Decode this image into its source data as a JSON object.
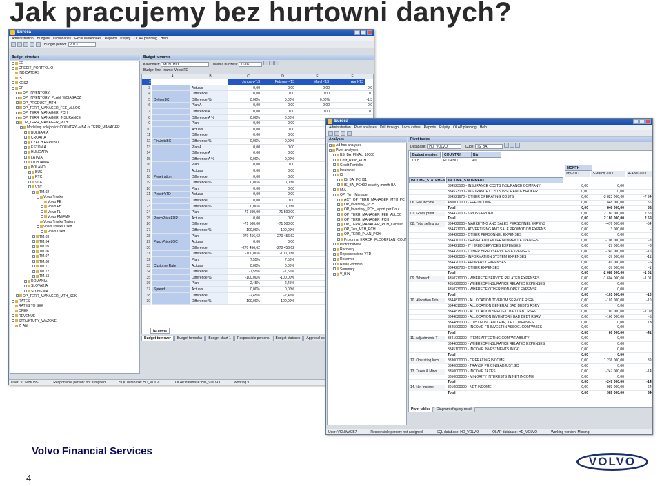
{
  "slide": {
    "title": "Jak pracujemy bez hurtowni danych?",
    "company": "Volvo Financial Services",
    "page_number": "4",
    "logo_text": "VOLVO"
  },
  "win1": {
    "title": "Eureca",
    "menu": [
      "Administration",
      "Budgets",
      "Dictionaries",
      "Excel Workbooks",
      "Reports",
      "Pulpity",
      "OLAP planning",
      "Help"
    ],
    "budget_period_label": "Budget period:",
    "budget_period_value": "2013",
    "left_panel_title": "Budget structure",
    "right_panel_title": "Budget turnover",
    "kalendarz_label": "Kalendarz:",
    "kalendarz_value": "MONTHLY",
    "wersja_label": "Wersja budżetu:",
    "wersja_value": "11/06",
    "node_label": "Budget line - name: Volvo FE",
    "tree": [
      {
        "t": "EG",
        "l": 0
      },
      {
        "t": "CREDIT_PORTFOLIO",
        "l": 0
      },
      {
        "t": "INDICATORS",
        "l": 0
      },
      {
        "t": "IS",
        "l": 0
      },
      {
        "t": "KOSZ",
        "l": 0
      },
      {
        "t": "OP",
        "l": 0
      },
      {
        "t": "OP_INVENTORY",
        "l": 1
      },
      {
        "t": "OP_INVENTORY_PLAN_WCIAGACZ",
        "l": 1
      },
      {
        "t": "OP_PRODUCT_MTH",
        "l": 1
      },
      {
        "t": "OP_TERR_MANAGER_FEE_ALLOC",
        "l": 1
      },
      {
        "t": "OP_TERR_MANAGER_PCH",
        "l": 1
      },
      {
        "t": "OP_TERR_MANAGER_INSURANCE",
        "l": 1
      },
      {
        "t": "OP_TERR_MANAGER_MTH",
        "l": 1
      },
      {
        "t": "Model wg kolejności: COUNTRY -> BA -> TERR_MANAGER",
        "l": 2
      },
      {
        "t": "BULGARIA",
        "l": 3
      },
      {
        "t": "CROATIA",
        "l": 3
      },
      {
        "t": "CZECH REPUBLIC",
        "l": 3
      },
      {
        "t": "ESTONIA",
        "l": 3
      },
      {
        "t": "HUNGARY",
        "l": 3
      },
      {
        "t": "LATVIA",
        "l": 3
      },
      {
        "t": "LITHUANIA",
        "l": 3
      },
      {
        "t": "POLAND",
        "l": 3
      },
      {
        "t": "BUS",
        "l": 4
      },
      {
        "t": "RTC",
        "l": 4
      },
      {
        "t": "VCE",
        "l": 4
      },
      {
        "t": "VTC",
        "l": 4
      },
      {
        "t": "TM.02",
        "l": 5
      },
      {
        "t": "Volvo Trucks",
        "l": 6
      },
      {
        "t": "Volvo FE",
        "l": 7
      },
      {
        "t": "Volvo FH",
        "l": 7
      },
      {
        "t": "Volvo FL",
        "l": 7
      },
      {
        "t": "Volvo FM/FMX",
        "l": 7
      },
      {
        "t": "Volvo Trucks Trailers",
        "l": 6
      },
      {
        "t": "Volvo Trucks Used",
        "l": 6
      },
      {
        "t": "Volvo Used",
        "l": 7
      },
      {
        "t": "TM.03",
        "l": 5
      },
      {
        "t": "TM.04",
        "l": 5
      },
      {
        "t": "TM.05",
        "l": 5
      },
      {
        "t": "TM.06",
        "l": 5
      },
      {
        "t": "TM.07",
        "l": 5
      },
      {
        "t": "TM.08",
        "l": 5
      },
      {
        "t": "TM.11",
        "l": 5
      },
      {
        "t": "TM.12",
        "l": 5
      },
      {
        "t": "TM.13",
        "l": 5
      },
      {
        "t": "ROMANIA",
        "l": 3
      },
      {
        "t": "SLOVAKIA",
        "l": 3
      },
      {
        "t": "SLOVENIA",
        "l": 3
      },
      {
        "t": "OP_TERR_MANAGER_MTH_SEK",
        "l": 1
      },
      {
        "t": "RATES",
        "l": 0
      },
      {
        "t": "RATES TO SEK",
        "l": 0
      },
      {
        "t": "OPEX",
        "l": 0
      },
      {
        "t": "REVENUE",
        "l": 0
      },
      {
        "t": "STRUKTURY_WAZONE",
        "l": 0
      },
      {
        "t": "Z_ANI",
        "l": 0
      }
    ],
    "col_letters": [
      "A",
      "B",
      "C",
      "D",
      "E",
      "F"
    ],
    "col_headers": [
      "January-'13",
      "February-'13",
      "March-'13",
      "April-'13"
    ],
    "rows": [
      {
        "n": "3",
        "a": "",
        "b": "Actuals",
        "c": "0,00",
        "d": "0,00",
        "e": "0,00",
        "f": "0,0"
      },
      {
        "n": "4",
        "a": "",
        "b": "Difference",
        "c": "0,00",
        "d": "0,00",
        "e": "0,00",
        "f": "0,0"
      },
      {
        "n": "5",
        "a": "DeliverBC",
        "b": "Difference %",
        "c": "0,00%",
        "d": "0,00%",
        "e": "0,00%",
        "f": "-1,3"
      },
      {
        "n": "6",
        "a": "",
        "b": "Plan A",
        "c": "0,00",
        "d": "0,00",
        "e": "0,00",
        "f": "0,0"
      },
      {
        "n": "7",
        "a": "",
        "b": "Difference A",
        "c": "0,00",
        "d": "0,00",
        "e": "0,00",
        "f": "0,0"
      },
      {
        "n": "8",
        "a": "",
        "b": "Difference A %",
        "c": "0,00%",
        "d": "0,00%",
        "e": "",
        "f": ""
      },
      {
        "n": "9",
        "a": "",
        "b": "Plan",
        "c": "0,00",
        "d": "0,00",
        "e": "",
        "f": ""
      },
      {
        "n": "10",
        "a": "",
        "b": "Actuals",
        "c": "0,00",
        "d": "0,00",
        "e": "",
        "f": ""
      },
      {
        "n": "11",
        "a": "",
        "b": "Difference",
        "c": "0,00",
        "d": "0,00",
        "e": "",
        "f": ""
      },
      {
        "n": "12",
        "a": "FinUnitsBC",
        "b": "Difference %",
        "c": "0,00%",
        "d": "0,00%",
        "e": "",
        "f": ""
      },
      {
        "n": "13",
        "a": "",
        "b": "Plan A",
        "c": "0,00",
        "d": "0,00",
        "e": "",
        "f": ""
      },
      {
        "n": "14",
        "a": "",
        "b": "Difference A",
        "c": "0,00",
        "d": "0,00",
        "e": "",
        "f": ""
      },
      {
        "n": "15",
        "a": "",
        "b": "Difference A %",
        "c": "0,00%",
        "d": "0,00%",
        "e": "",
        "f": ""
      },
      {
        "n": "16",
        "a": "",
        "b": "Plan",
        "c": "0,00",
        "d": "0,00",
        "e": "",
        "f": ""
      },
      {
        "n": "17",
        "a": "",
        "b": "Actuals",
        "c": "0,00",
        "d": "0,00",
        "e": "",
        "f": ""
      },
      {
        "n": "18",
        "a": "Penetration",
        "b": "Difference",
        "c": "0,00",
        "d": "0,00",
        "e": "",
        "f": ""
      },
      {
        "n": "19",
        "a": "",
        "b": "Difference %",
        "c": "0,00%",
        "d": "0,00%",
        "e": "",
        "f": ""
      },
      {
        "n": "20",
        "a": "",
        "b": "Plan",
        "c": "0,00",
        "d": "0,00",
        "e": "",
        "f": ""
      },
      {
        "n": "21",
        "a": "PenetrYTD",
        "b": "Actuals",
        "c": "0,00",
        "d": "0,00",
        "e": "",
        "f": ""
      },
      {
        "n": "22",
        "a": "",
        "b": "Difference",
        "c": "0,00",
        "d": "0,00",
        "e": "",
        "f": ""
      },
      {
        "n": "23",
        "a": "",
        "b": "Difference %",
        "c": "0,00%",
        "d": "0,00%",
        "e": "",
        "f": ""
      },
      {
        "n": "24",
        "a": "",
        "b": "Plan",
        "c": "71 500,00",
        "d": "71 500,00",
        "e": "7",
        "f": ""
      },
      {
        "n": "25",
        "a": "PurchPriceEUR",
        "b": "Actuals",
        "c": "0,00",
        "d": "0,00",
        "e": "",
        "f": ""
      },
      {
        "n": "26",
        "a": "",
        "b": "Difference",
        "c": "-71 500,00",
        "d": "-71 500,00",
        "e": "-7",
        "f": ""
      },
      {
        "n": "27",
        "a": "",
        "b": "Difference %",
        "c": "-100,00%",
        "d": "-100,00%",
        "e": "-",
        "f": ""
      },
      {
        "n": "28",
        "a": "",
        "b": "Plan",
        "c": "270 456,62",
        "d": "270 456,62",
        "e": "27",
        "f": ""
      },
      {
        "n": "29",
        "a": "PurchPriceLOC",
        "b": "Actuals",
        "c": "0,00",
        "d": "0,00",
        "e": "",
        "f": ""
      },
      {
        "n": "30",
        "a": "",
        "b": "Difference",
        "c": "-270 456,62",
        "d": "-270 456,62",
        "e": "-27",
        "f": ""
      },
      {
        "n": "31",
        "a": "",
        "b": "Difference %",
        "c": "-100,00%",
        "d": "-100,00%",
        "e": "-",
        "f": ""
      },
      {
        "n": "32",
        "a": "",
        "b": "Plan",
        "c": "7,55%",
        "d": "7,56%",
        "e": "",
        "f": ""
      },
      {
        "n": "33",
        "a": "CustomerRate",
        "b": "Actuals",
        "c": "0,00%",
        "d": "0,00%",
        "e": "",
        "f": ""
      },
      {
        "n": "34",
        "a": "",
        "b": "Difference",
        "c": "-7,55%",
        "d": "-7,56%",
        "e": "",
        "f": ""
      },
      {
        "n": "35",
        "a": "",
        "b": "Difference %",
        "c": "-100,00%",
        "d": "-100,00%",
        "e": "-",
        "f": ""
      },
      {
        "n": "36",
        "a": "",
        "b": "Plan",
        "c": "2,45%",
        "d": "2,45%",
        "e": "",
        "f": ""
      },
      {
        "n": "37",
        "a": "Spread",
        "b": "Actuals",
        "c": "0,00%",
        "d": "0,00%",
        "e": "",
        "f": ""
      },
      {
        "n": "38",
        "a": "",
        "b": "Difference",
        "c": "-2,45%",
        "d": "-2,45%",
        "e": "",
        "f": ""
      },
      {
        "n": "39",
        "a": "",
        "b": "Difference %",
        "c": "-100,00%",
        "d": "-100,00%",
        "e": "-",
        "f": ""
      }
    ],
    "sheet_tab": "turnover",
    "bottom_tabs": [
      "Budget turnover",
      "Budget formulas",
      "Budget chart 1",
      "Responsible persons",
      "Budget statuses",
      "Approval co"
    ],
    "status": [
      "User: VCN\\fw0357",
      "Responsible person: not assigned",
      "SQL database: HD_VOLVO",
      "OLAP database: HD_VOLVO",
      "Working v"
    ]
  },
  "win2": {
    "title": "Eureca",
    "menu": [
      "Administration",
      "Pivot analyses",
      "Drill through",
      "Local cubes",
      "Reports",
      "Pulpity",
      "OLAP planning",
      "Help"
    ],
    "left_panel_title": "Analyses",
    "right_panel_title": "Pivot tables",
    "database_label": "Database:",
    "database_value": "HD_VOLVO",
    "cube_label": "Cube:",
    "cube_value": "IS_BA",
    "tree": [
      {
        "t": "Ad-hoc analyses",
        "l": 0
      },
      {
        "t": "Pivot analyses",
        "l": 0
      },
      {
        "t": "BS_BA_FINAL_10000",
        "l": 1
      },
      {
        "t": "Cost_Ratio_PCH",
        "l": 1
      },
      {
        "t": "Credit Portfolio",
        "l": 1
      },
      {
        "t": "Insurance",
        "l": 1
      },
      {
        "t": "IS",
        "l": 1
      },
      {
        "t": "IS_BA_PCH01",
        "l": 2
      },
      {
        "t": "IS_BA_PCH02 country-month-BA",
        "l": 2
      },
      {
        "t": "MIA",
        "l": 1
      },
      {
        "t": "OP_Terr_Manager",
        "l": 1
      },
      {
        "t": "ACT_OP_TERR_MANAGER_MTH_PC",
        "l": 2
      },
      {
        "t": "OP_Inventory_PCH",
        "l": 2
      },
      {
        "t": "OP_Inventory_PCH_report per Cou",
        "l": 2
      },
      {
        "t": "OP_TERR_MANAGER_FEE_ALLOC",
        "l": 2
      },
      {
        "t": "OP_TERR_MANAGER_PCH",
        "l": 2
      },
      {
        "t": "OP_TERR_MANAGER_PCH_Consult",
        "l": 2
      },
      {
        "t": "OP_Terr_MTH_PCH",
        "l": 2
      },
      {
        "t": "OP_TERR_PLAN_PCH",
        "l": 2
      },
      {
        "t": "Proforma_ERROR_FLOORPLAN_COUNT",
        "l": 2
      },
      {
        "t": "ProformaMise",
        "l": 1
      },
      {
        "t": "Recovery",
        "l": 1
      },
      {
        "t": "Repossessions YTD",
        "l": 1
      },
      {
        "t": "Reserves",
        "l": 1
      },
      {
        "t": "Retail Portfolio",
        "l": 1
      },
      {
        "t": "Summary",
        "l": 1
      },
      {
        "t": "V_BIN",
        "l": 1
      }
    ],
    "filter_headers": [
      "Budget version",
      "COUNTRY",
      "BA"
    ],
    "filter_values": [
      "1108",
      "POLAND",
      "All"
    ],
    "month_label": "MONTH",
    "col_headers": [
      "ary-2011",
      "3-March 2011",
      "4-April 2011"
    ],
    "row_headers": [
      "INCOME_STATEMENT",
      "INCOME_STATEMENT"
    ],
    "rows": [
      {
        "g": "",
        "c": "334523100 - INSURANCE COSTS INSURANCE COMPANY",
        "v1": "0,00",
        "v2": "0,00",
        "v3": "0,00"
      },
      {
        "g": "",
        "c": "334523130 - INSURANCE COSTS INSURANCE BROKER",
        "v1": "0,00",
        "v2": "0,00",
        "v3": "0,00"
      },
      {
        "g": "",
        "c": "334521670 - OTHER OPERATING COSTS",
        "v1": "0,00",
        "v2": "-3 823 000,00",
        "v3": "-7 946 000"
      },
      {
        "g": "06. Fee Income",
        "c": "4800001000 - FEE INCOME",
        "v1": "0,00",
        "v2": "848 000,00",
        "v3": "562 000"
      },
      {
        "g": "",
        "c": "Total",
        "v1": "0,00",
        "v2": "848 000,00",
        "v3": "562 000"
      },
      {
        "g": "07. Gross profit",
        "c": "334422000 - GROSS PROFIT",
        "v1": "0,00",
        "v2": "2 180 000,00",
        "v3": "2 555 000"
      },
      {
        "g": "",
        "c": "Total",
        "v1": "0,00",
        "v2": "2 180 000,00",
        "v3": "2 555 000"
      },
      {
        "g": "08. Total selling sp",
        "c": "334422000 - MARKETING AND SALES PERSONNEL EXPENS",
        "v1": "0,00",
        "v2": "-476 000,00",
        "v3": "-541 000"
      },
      {
        "g": "",
        "c": "334421000 - ADVERTISING AND SALE PROMOTION EXPENS",
        "v1": "0,00",
        "v2": "3 000,00",
        "v3": "-2 000"
      },
      {
        "g": "",
        "c": "334420000 - OTHER PERSONNEL EXPENSES",
        "v1": "0,00",
        "v2": "0,00",
        "v3": "0"
      },
      {
        "g": "",
        "c": "334410000 - TRAVEL AND ENTERTAINMENT EXPENSES",
        "v1": "0,00",
        "v2": "-106 000,00",
        "v3": "-76 000"
      },
      {
        "g": "",
        "c": "334421000 - IT HIRED SERVICES EXPENSES",
        "v1": "0,00",
        "v2": "-27 000,00",
        "v3": "-35 000"
      },
      {
        "g": "",
        "c": "334429000 - OTHER HIRED SERVICES EXPENSES",
        "v1": "0,00",
        "v2": "-240 000,00",
        "v3": "-165 000"
      },
      {
        "g": "",
        "c": "334420000 - INFORMATION SYSTEM EXPENSES",
        "v1": "0,00",
        "v2": "-37 000,00",
        "v3": "-115 000"
      },
      {
        "g": "",
        "c": "334420000 - PROPERTY EXPENSES",
        "v1": "0,00",
        "v2": "-69 000,00",
        "v3": "-68 000"
      },
      {
        "g": "",
        "c": "334420700 - OTHER EXPENSES",
        "v1": "0,00",
        "v2": "-37 000,00",
        "v3": "-17 000"
      },
      {
        "g": "",
        "c": "Total",
        "v1": "0,00",
        "v2": "-2 088 000,00",
        "v3": "-1 013 000"
      },
      {
        "g": "09. Whereof",
        "c": "4350210000 - WHEREOF SERVICE RELATED EXPENSES",
        "v1": "0,00",
        "v2": "-1 604 000,00",
        "v3": "-1 012 000"
      },
      {
        "g": "",
        "c": "4350220000 - WHEREOF INSURANCE RELATED EXPENSES",
        "v1": "0,00",
        "v2": "0,00",
        "v3": "0"
      },
      {
        "g": "",
        "c": "4350230000 - WHEREOF OTHER NON-OPEX EXPENSE",
        "v1": "0,00",
        "v2": "0,00",
        "v3": "0"
      },
      {
        "g": "",
        "c": "Total",
        "v1": "0,00",
        "v2": "-101 000,00",
        "v3": "-101 000"
      },
      {
        "g": "10. Allocation Tota",
        "c": "3344810000 - ALLOCATION TO/FROM SERVICE RSRV",
        "v1": "0,00",
        "v2": "-101 000,00",
        "v3": "-101 000"
      },
      {
        "g": "",
        "c": "3344810000 - ALLOCATION GENERAL BAD DEBTS RSRV",
        "v1": "0,00",
        "v2": "0,00",
        "v3": "0"
      },
      {
        "g": "",
        "c": "3344815000 - ALLOCATION SPECIFIC BAD DEBT RSRV",
        "v1": "0,00",
        "v2": "780 000,00",
        "v3": "-1 099 000"
      },
      {
        "g": "",
        "c": "3344820000 - ALLOCATION INVENTORY BAD DEBT RSRV",
        "v1": "0,00",
        "v2": "-160 000,00",
        "v3": "-52 000"
      },
      {
        "g": "",
        "c": "3344860000 - OTH OP INC AND EXP, 3 P COMPANIES",
        "v1": "0,00",
        "v2": "0,00",
        "v3": "736 000"
      },
      {
        "g": "",
        "c": "3345000000 - INCOME FR INVEST IN ASSOC. COMPANIES",
        "v1": "0,00",
        "v2": "0,00",
        "v3": "0"
      },
      {
        "g": "",
        "c": "Total",
        "v1": "0,00",
        "v2": "60 000,00",
        "v3": "-415 000"
      },
      {
        "g": "11. Adjustments T",
        "c": "3341000000 - ITEMS AFFECTING COMPARABILITY",
        "v1": "0,00",
        "v2": "0,00",
        "v3": "0"
      },
      {
        "g": "",
        "c": "3344000000 - WHEREOF INSURANCE RELATED EXPENSES",
        "v1": "0,00",
        "v2": "0,00",
        "v3": "0"
      },
      {
        "g": "",
        "c": "3345100000 - INCOME INVESTMENTS IN GC",
        "v1": "0,00",
        "v2": "0,00",
        "v3": "0"
      },
      {
        "g": "",
        "c": "Total",
        "v1": "0,00",
        "v2": "0,00",
        "v3": "0"
      },
      {
        "g": "12. Operating Inco",
        "c": "3330000000 - OPERATING INCOME",
        "v1": "0,00",
        "v2": "1 236 000,00",
        "v3": "891 000"
      },
      {
        "g": "",
        "c": "3340000000 - TRANSF PRICING ADJUST.GC",
        "v1": "0,00",
        "v2": "0,00",
        "v3": "0"
      },
      {
        "g": "13. Taxes & Mino",
        "c": "3350000000 - INCOME TAXES",
        "v1": "0,00",
        "v2": "-247 000,00",
        "v3": "-145 000"
      },
      {
        "g": "",
        "c": "3050000000 - MINORITY INTERESTS IN NET INCOME",
        "v1": "0,00",
        "v2": "0,00",
        "v3": "0"
      },
      {
        "g": "",
        "c": "Total",
        "v1": "0,00",
        "v2": "-247 000,00",
        "v3": "-145 000"
      },
      {
        "g": "14. Net Income",
        "c": "8010000000 - NET INCOME",
        "v1": "0,00",
        "v2": "989 000,00",
        "v3": "646 000"
      },
      {
        "g": "",
        "c": "Total",
        "v1": "0,00",
        "v2": "989 000,00",
        "v3": "646 000"
      }
    ],
    "bottom_tabs": [
      "Pivot tables",
      "Diagram of query result"
    ],
    "status": [
      "User: VCN\\fw0357",
      "Responsible person: not assigned",
      "SQL database: HD_VOLVO",
      "OLAP database: HD_VOLVO",
      "Working version: Missing"
    ]
  }
}
